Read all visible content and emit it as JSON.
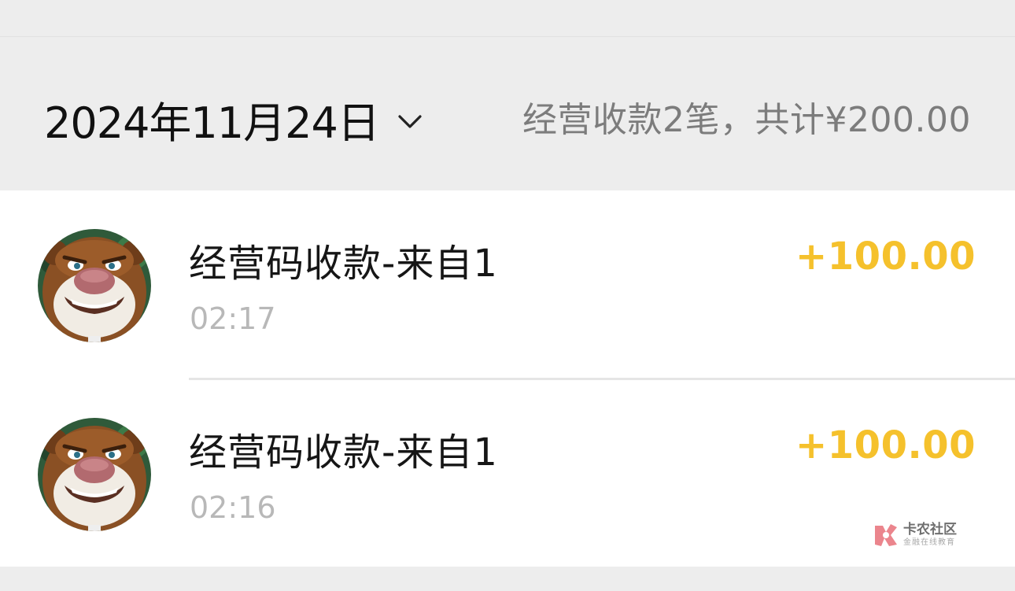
{
  "header": {
    "date": "2024年11月24日",
    "summary": "经营收款2笔，共计¥200.00"
  },
  "colors": {
    "amount": "#f5c12c",
    "background": "#ededed",
    "row_background": "#ffffff"
  },
  "transactions": [
    {
      "title": "经营码收款-来自1",
      "time": "02:17",
      "amount": "+100.00",
      "avatar_icon": "bear-avatar"
    },
    {
      "title": "经营码收款-来自1",
      "time": "02:16",
      "amount": "+100.00",
      "avatar_icon": "bear-avatar"
    }
  ],
  "watermark": {
    "name": "卡农社区",
    "tagline": "金融在线教育"
  }
}
